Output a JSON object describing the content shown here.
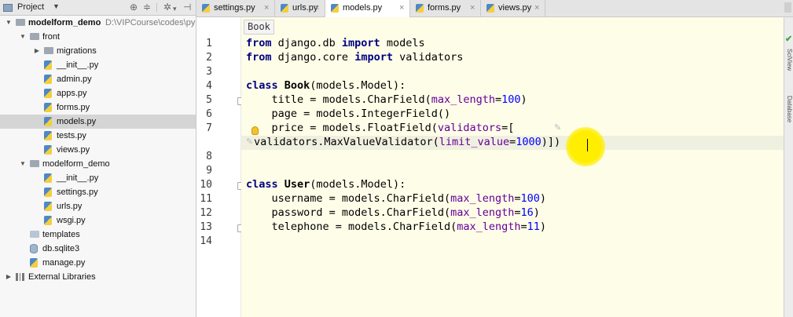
{
  "project_panel": {
    "title": "Project",
    "tree": [
      {
        "label": "modelform_demo",
        "path": "D:\\VIPCourse\\codes\\py",
        "type": "root",
        "depth": 0,
        "expanded": true
      },
      {
        "label": "front",
        "type": "folder",
        "depth": 1,
        "expanded": true
      },
      {
        "label": "migrations",
        "type": "folder",
        "depth": 2,
        "expanded": false
      },
      {
        "label": "__init__.py",
        "type": "py",
        "depth": 2
      },
      {
        "label": "admin.py",
        "type": "py",
        "depth": 2
      },
      {
        "label": "apps.py",
        "type": "py",
        "depth": 2
      },
      {
        "label": "forms.py",
        "type": "py",
        "depth": 2
      },
      {
        "label": "models.py",
        "type": "py",
        "depth": 2,
        "selected": true
      },
      {
        "label": "tests.py",
        "type": "py",
        "depth": 2
      },
      {
        "label": "views.py",
        "type": "py",
        "depth": 2
      },
      {
        "label": "modelform_demo",
        "type": "folder",
        "depth": 1,
        "expanded": true
      },
      {
        "label": "__init__.py",
        "type": "py",
        "depth": 2
      },
      {
        "label": "settings.py",
        "type": "py",
        "depth": 2
      },
      {
        "label": "urls.py",
        "type": "py",
        "depth": 2
      },
      {
        "label": "wsgi.py",
        "type": "py",
        "depth": 2
      },
      {
        "label": "templates",
        "type": "folder-light",
        "depth": 1
      },
      {
        "label": "db.sqlite3",
        "type": "db",
        "depth": 1
      },
      {
        "label": "manage.py",
        "type": "py",
        "depth": 1
      },
      {
        "label": "External Libraries",
        "type": "lib",
        "depth": 0,
        "expanded": false
      }
    ]
  },
  "tabs": [
    {
      "label": "settings.py",
      "active": false
    },
    {
      "label": "urls.py",
      "active": false
    },
    {
      "label": "models.py",
      "active": true
    },
    {
      "label": "forms.py",
      "active": false
    },
    {
      "label": "views.py",
      "active": false
    }
  ],
  "editor": {
    "breadcrumb": "Book",
    "lines": [
      {
        "n": "1",
        "tokens": [
          [
            "kw",
            "from"
          ],
          [
            "t",
            " django.db "
          ],
          [
            "kw",
            "import"
          ],
          [
            "t",
            " models"
          ]
        ]
      },
      {
        "n": "2",
        "tokens": [
          [
            "kw",
            "from"
          ],
          [
            "t",
            " django.core "
          ],
          [
            "kw",
            "import"
          ],
          [
            "t",
            " validators"
          ]
        ]
      },
      {
        "n": "3",
        "tokens": []
      },
      {
        "n": "4",
        "tokens": [
          [
            "kw",
            "class"
          ],
          [
            "t",
            " "
          ],
          [
            "cls",
            "Book"
          ],
          [
            "t",
            "(models.Model):"
          ]
        ]
      },
      {
        "n": "5",
        "tokens": [
          [
            "t",
            "    title = models.CharField("
          ],
          [
            "kwarg",
            "max_length"
          ],
          [
            "t",
            "="
          ],
          [
            "num",
            "100"
          ],
          [
            "t",
            ")"
          ]
        ]
      },
      {
        "n": "6",
        "tokens": [
          [
            "t",
            "    page = models.IntegerField()"
          ]
        ]
      },
      {
        "n": "7",
        "tokens": [
          [
            "t",
            "    price = models.FloatField("
          ],
          [
            "kwarg",
            "validators"
          ],
          [
            "t",
            "=["
          ]
        ]
      },
      {
        "n": "",
        "tokens": [
          [
            "t",
            "validators.MaxValueValidator("
          ],
          [
            "kwarg",
            "limit_value"
          ],
          [
            "t",
            "="
          ],
          [
            "num",
            "1000"
          ],
          [
            "t",
            ")])"
          ]
        ]
      },
      {
        "n": "8",
        "tokens": []
      },
      {
        "n": "9",
        "tokens": []
      },
      {
        "n": "10",
        "tokens": [
          [
            "kw",
            "class"
          ],
          [
            "t",
            " "
          ],
          [
            "cls",
            "User"
          ],
          [
            "t",
            "(models.Model):"
          ]
        ]
      },
      {
        "n": "11",
        "tokens": [
          [
            "t",
            "    username = models.CharField("
          ],
          [
            "kwarg",
            "max_length"
          ],
          [
            "t",
            "="
          ],
          [
            "num",
            "100"
          ],
          [
            "t",
            ")"
          ]
        ]
      },
      {
        "n": "12",
        "tokens": [
          [
            "t",
            "    password = models.CharField("
          ],
          [
            "kwarg",
            "max_length"
          ],
          [
            "t",
            "="
          ],
          [
            "num",
            "16"
          ],
          [
            "t",
            ")"
          ]
        ]
      },
      {
        "n": "13",
        "tokens": [
          [
            "t",
            "    telephone = models.CharField("
          ],
          [
            "kwarg",
            "max_length"
          ],
          [
            "t",
            "="
          ],
          [
            "num",
            "11"
          ],
          [
            "t",
            ")"
          ]
        ]
      },
      {
        "n": "14",
        "tokens": []
      }
    ]
  },
  "right_strip": {
    "labels": [
      "SciView",
      "Database"
    ]
  }
}
